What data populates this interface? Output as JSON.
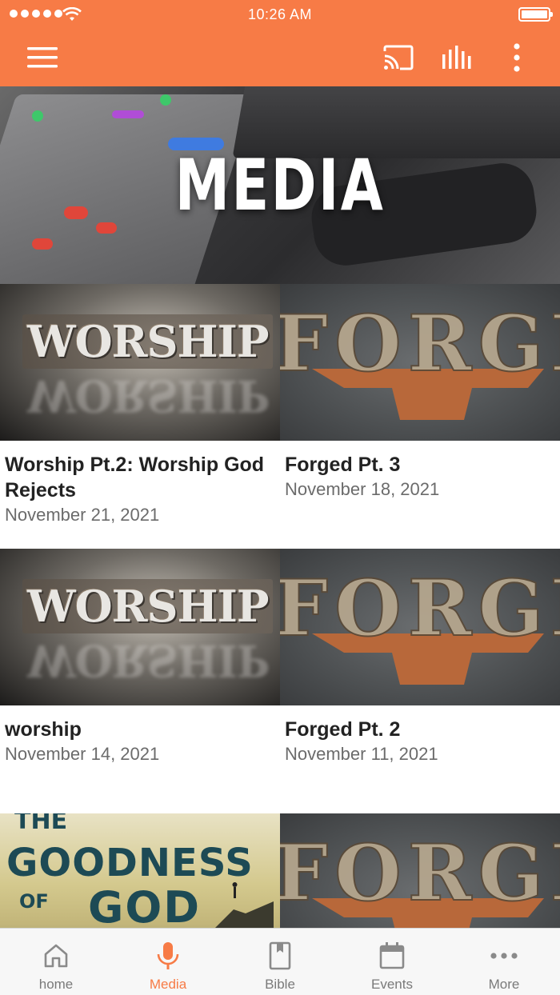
{
  "status": {
    "time": "10:26 AM"
  },
  "header": {
    "title": "MEDIA"
  },
  "media_items": [
    {
      "title": "Worship Pt.2: Worship God Rejects",
      "date": "November 21, 2021",
      "thumb": "WORSHIP"
    },
    {
      "title": "Forged Pt. 3",
      "date": "November 18, 2021",
      "thumb": "FORGED"
    },
    {
      "title": "worship",
      "date": "November 14, 2021",
      "thumb": "WORSHIP"
    },
    {
      "title": "Forged Pt. 2",
      "date": "November 11, 2021",
      "thumb": "FORGED"
    },
    {
      "title": "",
      "date": "",
      "thumb": "THE GOODNESS OF GOD"
    },
    {
      "title": "",
      "date": "",
      "thumb": "FORGED"
    }
  ],
  "thumb_text": {
    "worship": "WORSHIP",
    "forged": "FORGED",
    "goodness_the": "THE",
    "goodness_goodness": "GOODNESS",
    "goodness_of": "OF",
    "goodness_god": "GOD"
  },
  "tabs": [
    {
      "label": "home",
      "icon": "home-icon"
    },
    {
      "label": "Media",
      "icon": "microphone-icon",
      "active": true
    },
    {
      "label": "Bible",
      "icon": "bible-icon"
    },
    {
      "label": "Events",
      "icon": "calendar-icon"
    },
    {
      "label": "More",
      "icon": "more-icon"
    }
  ],
  "colors": {
    "accent": "#f77b46",
    "tab_inactive": "#7a7a7a"
  }
}
